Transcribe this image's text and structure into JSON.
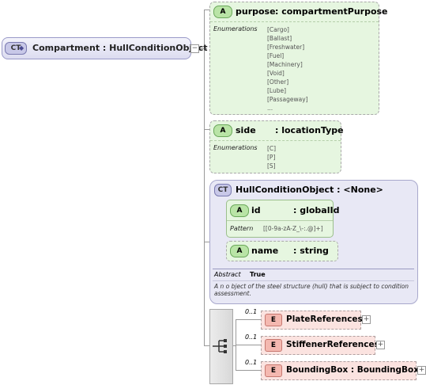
{
  "root": {
    "badge": "CT",
    "title": "Compartment : HullConditionObject"
  },
  "purpose": {
    "badge": "A",
    "name": "purpose",
    "type": ": compartmentPurpose",
    "enum_label": "Enumerations",
    "values": [
      "[Cargo]",
      "[Ballast]",
      "[Freshwater]",
      "[Fuel]",
      "[Machinery]",
      "[Void]",
      "[Other]",
      "[Lube]",
      "[Passageway]",
      "..."
    ]
  },
  "side": {
    "badge": "A",
    "name": "side",
    "type": ": locationType",
    "enum_label": "Enumerations",
    "values": [
      "[C]",
      "[P]",
      "[S]"
    ]
  },
  "hco": {
    "badge": "CT",
    "title": "HullConditionObject : <None>",
    "id_attr": {
      "badge": "A",
      "name": "id",
      "type": ": globalId",
      "pattern_label": "Pattern",
      "pattern": "[[0-9a-zA-Z_\\-:.@]+]"
    },
    "name_attr": {
      "badge": "A",
      "name": "name",
      "type": ": string"
    },
    "abstract_label": "Abstract",
    "abstract_value": "True",
    "description": "A n o bject of the steel structure (hull) that is subject to condition assessment."
  },
  "elements": [
    {
      "mult": "0..1",
      "badge": "E",
      "name": "PlateReferences"
    },
    {
      "mult": "0..1",
      "badge": "E",
      "name": "StiffenerReferences"
    },
    {
      "mult": "0..1",
      "badge": "E",
      "name": "BoundingBox : BoundingBox"
    }
  ],
  "colors": {
    "attr_fill": "#e6f6e0",
    "attr_badge": "#b9e4a6",
    "ct_fill": "#e8e8f5",
    "ct_badge": "#c8c8e8",
    "elem_fill": "#fbe3e0",
    "elem_badge": "#f4b8b0",
    "connector": "#999999"
  }
}
